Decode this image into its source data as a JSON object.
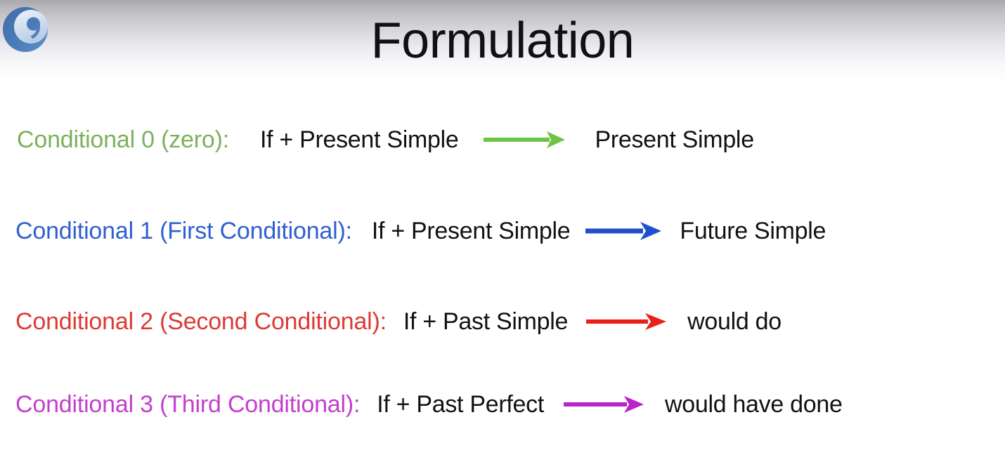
{
  "slide": {
    "title": "Formulation",
    "logo_icon": "quote-bubble-logo",
    "background_top_color": "#a9a9ad",
    "background_bottom_color": "#ffffff"
  },
  "rows": [
    {
      "label": "Conditional 0 (zero):",
      "label_color": "#7cb15c",
      "condition": "If + Present Simple",
      "arrow_icon": "right-arrow-icon",
      "arrow_color": "#6ec445",
      "result": "Present Simple"
    },
    {
      "label": "Conditional 1 (First Conditional):",
      "label_color": "#3060cf",
      "condition": "If + Present Simple",
      "arrow_icon": "right-arrow-icon",
      "arrow_color": "#2150cc",
      "result": "Future Simple"
    },
    {
      "label": "Conditional 2 (Second Conditional):",
      "label_color": "#dd3a35",
      "condition": "If + Past Simple",
      "arrow_icon": "right-arrow-icon",
      "arrow_color": "#e8201c",
      "result": "would do"
    },
    {
      "label": "Conditional 3 (Third Conditional):",
      "label_color": "#c340cd",
      "condition": "If + Past Perfect",
      "arrow_icon": "right-arrow-icon",
      "arrow_color": "#bb22c9",
      "result": "would have done"
    }
  ]
}
